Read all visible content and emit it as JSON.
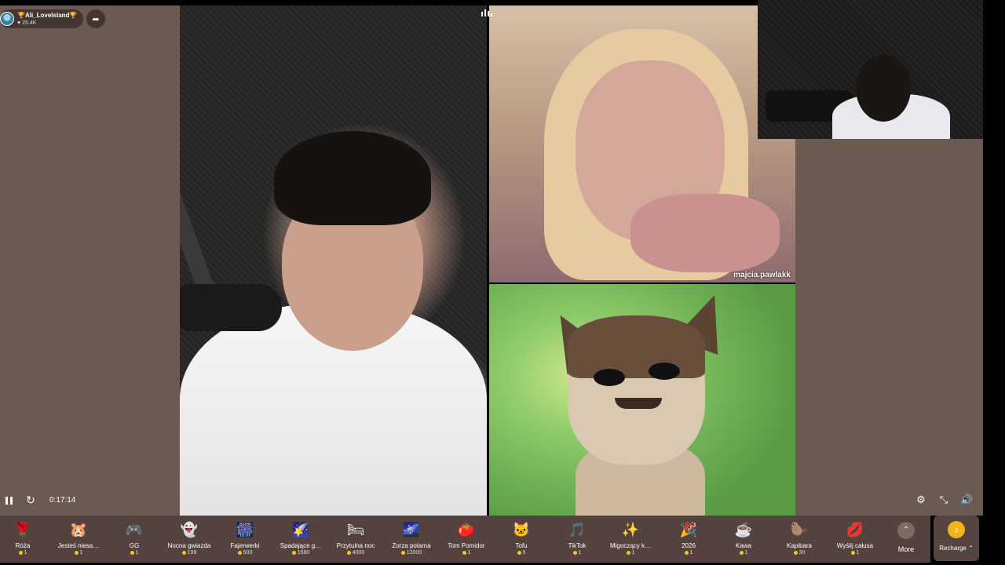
{
  "host": {
    "name": "🏆Ali_LoveIsland🏆",
    "likes": "25.4K"
  },
  "guest1": {
    "name": "majcia.pawlakk"
  },
  "player": {
    "time": "0:17:14"
  },
  "gifts": [
    {
      "name": "Róża",
      "price": "1",
      "icon": "🌹"
    },
    {
      "name": "Jesteś niesa…",
      "price": "1",
      "icon": "🐹"
    },
    {
      "name": "GG",
      "price": "1",
      "icon": "🎮"
    },
    {
      "name": "Nocna gwiazda",
      "price": "199",
      "icon": "👻"
    },
    {
      "name": "Fajerwerki",
      "price": "500",
      "icon": "🎆"
    },
    {
      "name": "Spadające g…",
      "price": "1580",
      "icon": "🌠"
    },
    {
      "name": "Przytulna noc",
      "price": "4000",
      "icon": "🛏"
    },
    {
      "name": "Zorza polarna",
      "price": "12000",
      "icon": "🌌"
    },
    {
      "name": "Tom Pomidor",
      "price": "1",
      "icon": "🍅"
    },
    {
      "name": "Tofu",
      "price": "5",
      "icon": "🐱"
    },
    {
      "name": "TikTok",
      "price": "1",
      "icon": "🎵"
    },
    {
      "name": "Migoczący k…",
      "price": "1",
      "icon": "✨"
    },
    {
      "name": "2026",
      "price": "1",
      "icon": "🎉"
    },
    {
      "name": "Kawa",
      "price": "1",
      "icon": "☕"
    },
    {
      "name": "Kapibara",
      "price": "30",
      "icon": "🦫"
    },
    {
      "name": "Wyślij całusa",
      "price": "1",
      "icon": "💋"
    }
  ],
  "more_label": "More",
  "recharge_label": "Recharge",
  "icons": {
    "share": "share-icon",
    "pause": "pause-icon",
    "replay": "replay-icon",
    "settings": "settings-icon",
    "collapse": "collapse-icon",
    "volume": "volume-icon",
    "signal": "signal-icon"
  },
  "colors": {
    "panel": "#6b5a52",
    "coin": "#f3c12f",
    "recharge": "#f3b31c"
  }
}
